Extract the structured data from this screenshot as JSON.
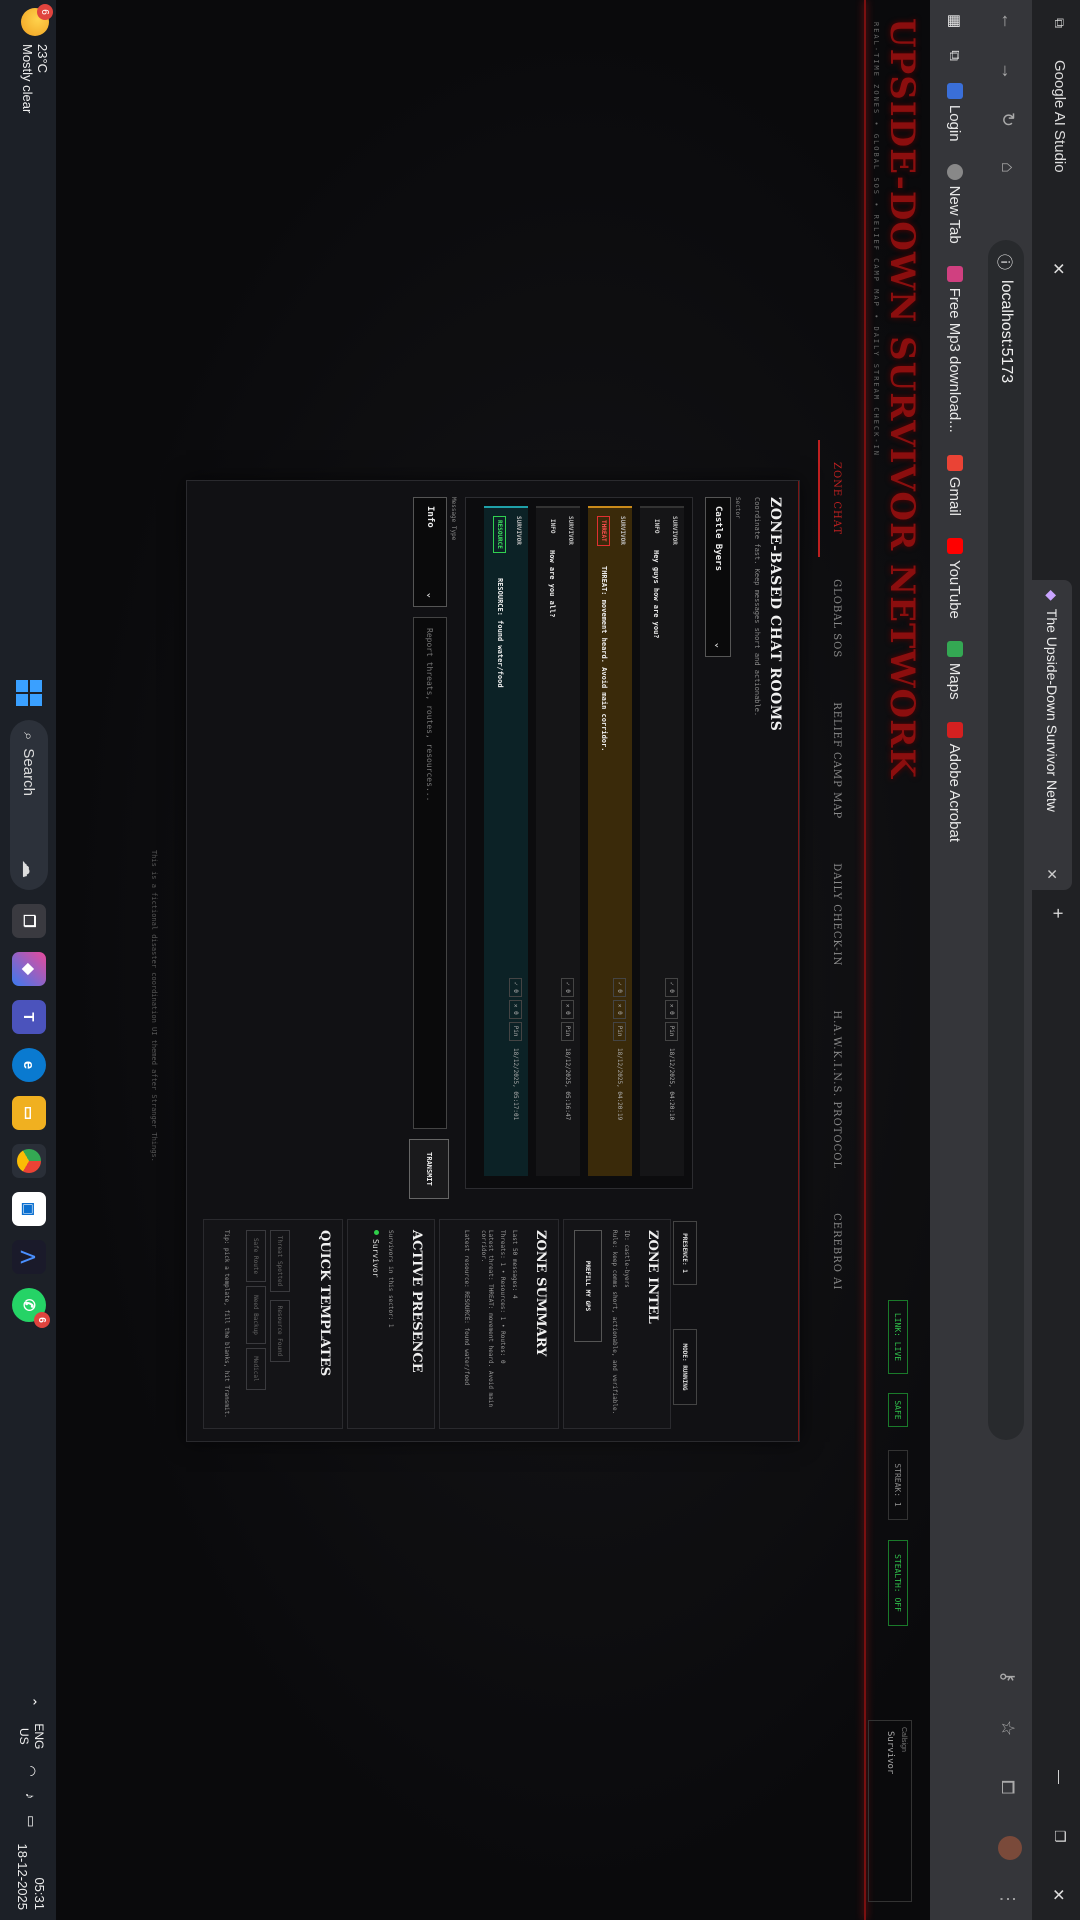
{
  "browser": {
    "left_tab": "Google AI Studio",
    "tab_title": "The Upside-Down Survivor Netw",
    "url": "localhost:5173",
    "bookmarks": [
      "Login",
      "New Tab",
      "Free Mp3 download...",
      "Gmail",
      "YouTube",
      "Maps",
      "Adobe Acrobat"
    ]
  },
  "header": {
    "brand": "UPSIDE-DOWN SURVIVOR NETWORK",
    "brand_sub": "REAL-TIME ZONES • GLOBAL SOS • RELIEF CAMP MAP • DAILY STREAM CHECK-IN",
    "link_pill": "LINK: LIVE",
    "safe_pill": "SAFE",
    "stream_pill": "STREAK: 1",
    "stealth_pill": "STEALTH: OFF",
    "callsign_label": "Callsign",
    "callsign_value": "Survivor"
  },
  "nav": [
    "ZONE CHAT",
    "GLOBAL SOS",
    "RELIEF CAMP MAP",
    "DAILY CHECK-IN",
    "H.A.W.K.I.N.S. PROTOCOL",
    "CEREBRO AI"
  ],
  "panel": {
    "title": "ZONE-BASED CHAT ROOMS",
    "subtitle": "Coordinate fast. Keep messages short and actionable.",
    "sector_label": "Sector",
    "sector_value": "Castle Byers",
    "presence": "PRESENCE: 1",
    "mode": "MODE: RUNNING",
    "messages": [
      {
        "who": "SURVIVOR",
        "tag": "INFO",
        "text": "Hey guys how are you?",
        "ts": "18/12/2025, 04:20:10",
        "kind": "info"
      },
      {
        "who": "SURVIVOR",
        "tag": "THREAT",
        "text": "THREAT: movement heard. Avoid main corridor.",
        "ts": "18/12/2025, 04:20:19",
        "kind": "threat"
      },
      {
        "who": "SURVIVOR",
        "tag": "INFO",
        "text": "How are you all?",
        "ts": "18/12/2025, 05:16:47",
        "kind": "info"
      },
      {
        "who": "SURVIVOR",
        "tag": "RESOURCE",
        "text": "RESOURCE: found water/food",
        "ts": "18/12/2025, 05:17:01",
        "kind": "resource"
      }
    ],
    "msg_actions": [
      "✓ 0",
      "✕ 0",
      "Pin"
    ],
    "message_type_label": "Message Type",
    "message_type_value": "Info",
    "compose_placeholder": "Report threats, routes, resources...",
    "transmit": "TRANSMIT"
  },
  "intel": {
    "title": "ZONE INTEL",
    "id": "ID: castle-byers",
    "rule": "Rule: keep comms short, actionable, and verifiable.",
    "button": "PREFILL MY GPS"
  },
  "summary": {
    "title": "ZONE SUMMARY",
    "lines": [
      "Last 50 messages: 4",
      "Threats: 1 • Resources: 1 • Routes: 0",
      "Latest threat: THREAT: movement heard. Avoid main corridor.",
      "Latest resource: RESOURCE: found water/food"
    ]
  },
  "presence": {
    "title": "ACTIVE PRESENCE",
    "line": "Survivors in this sector: 1",
    "user": "Survivor"
  },
  "templates": {
    "title": "QUICK TEMPLATES",
    "buttons": [
      "Threat Spotted",
      "Resource Found",
      "Safe Route",
      "Need Backup",
      "Medical"
    ],
    "tip": "Tip: pick a template, fill the blanks, hit Transmit."
  },
  "footer": "This is a fictional disaster coordination UI themed after Stranger Things.",
  "taskbar": {
    "temp": "23°C",
    "weather": "Mostly clear",
    "weather_badge": "6",
    "search": "Search",
    "whatsapp_badge": "6",
    "lang1": "ENG",
    "lang2": "US",
    "time": "05:31",
    "date": "18-12-2025"
  }
}
